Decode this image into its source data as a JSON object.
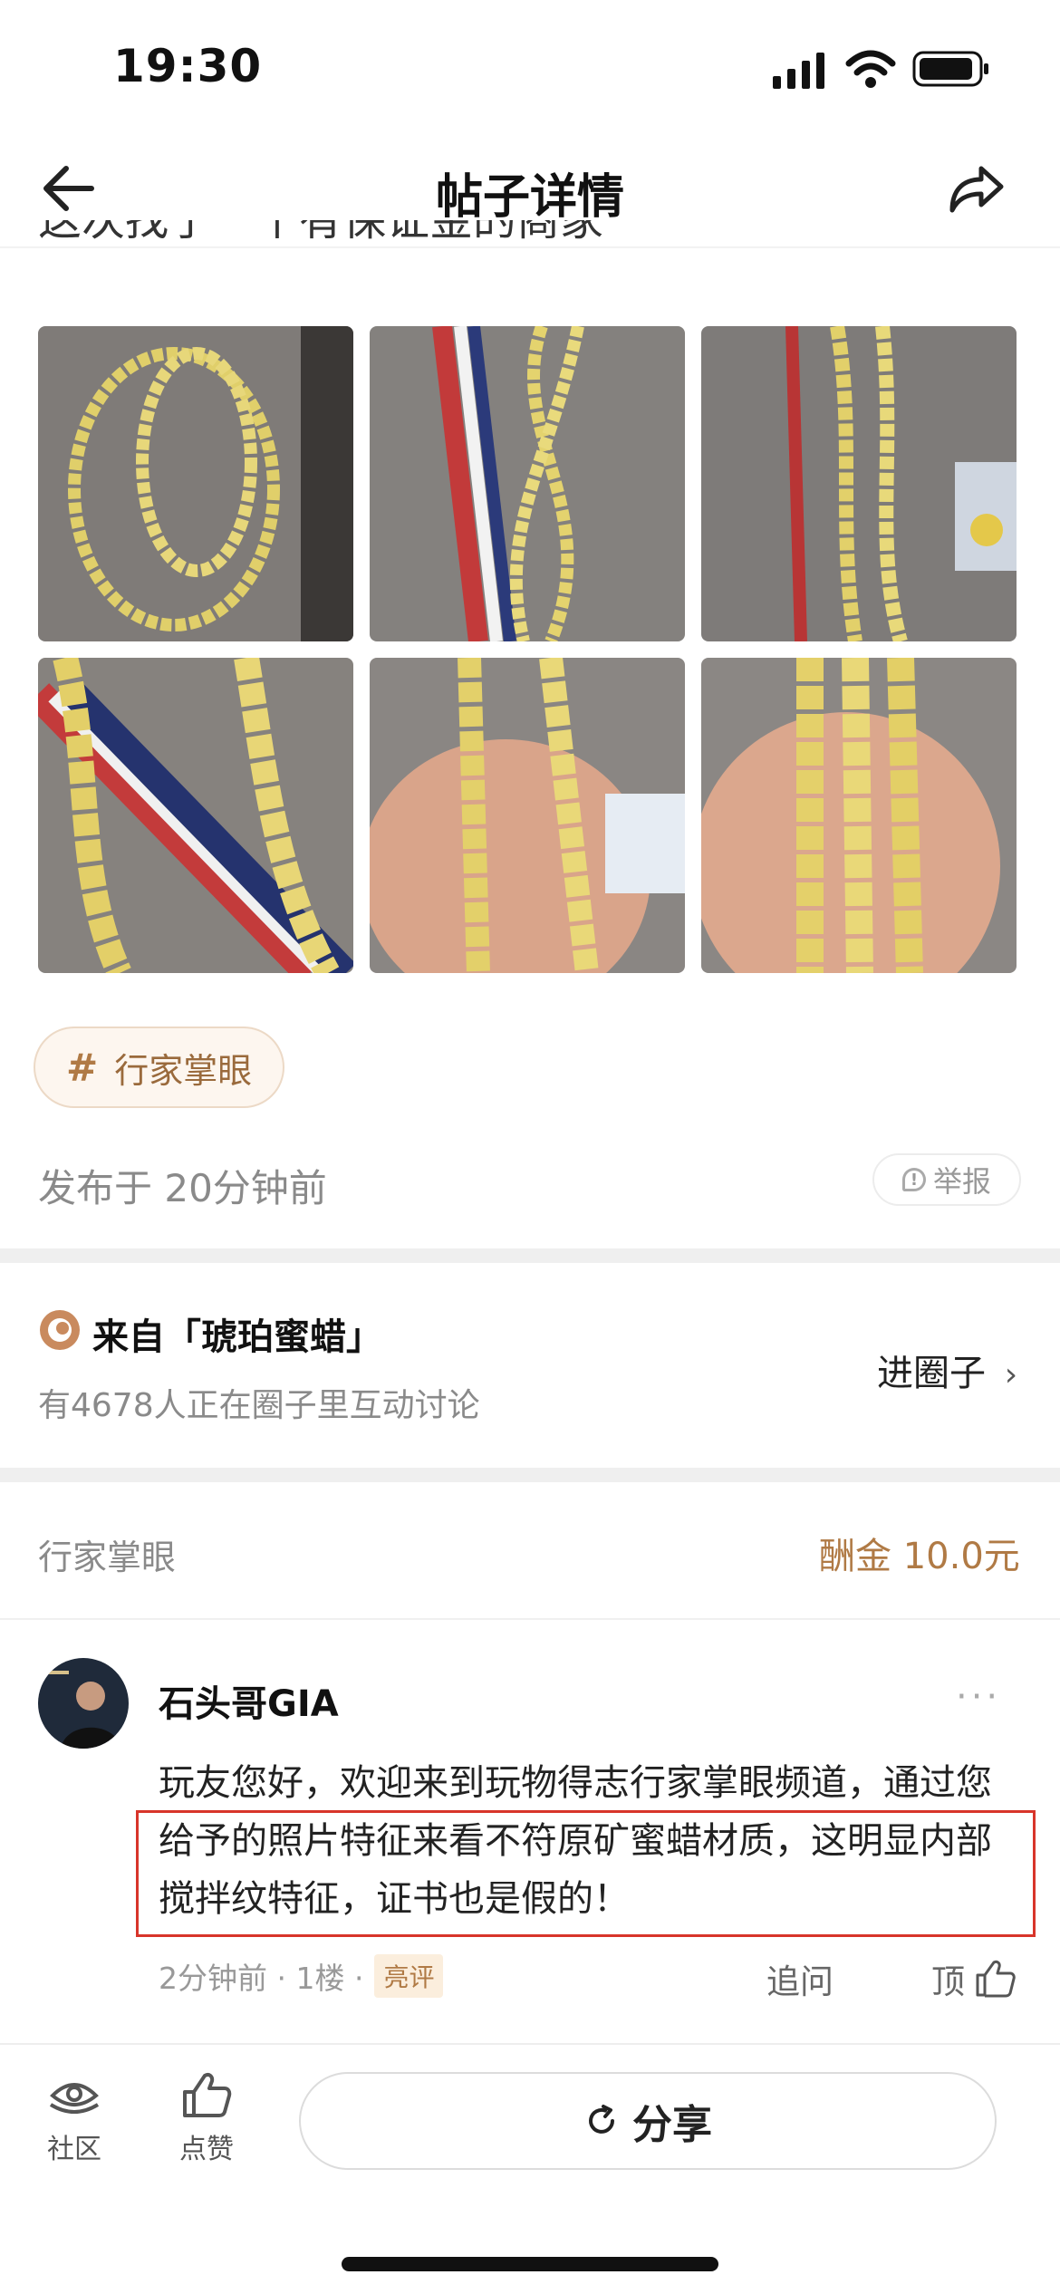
{
  "status_bar": {
    "time": "19:30"
  },
  "nav": {
    "title": "帖子详情"
  },
  "post": {
    "cut_text": "这次找了一个有保证金的商家",
    "topic_tag": "行家掌眼",
    "published": "发布于 20分钟前",
    "report_label": "举报"
  },
  "circle": {
    "title": "来自「琥珀蜜蜡」",
    "subtitle": "有4678人正在圈子里互动讨论",
    "enter_label": "进圈子"
  },
  "reply_section": {
    "label": "行家掌眼",
    "reward": "酬金 10.0元"
  },
  "comment": {
    "username": "石头哥GIA",
    "text": "玩友您好，欢迎来到玩物得志行家掌眼频道，通过您给予的照片特征来看不符原矿蜜蜡材质，这明显内部搅拌纹特征，证书也是假的！",
    "meta": "2分钟前 · 1楼 ·",
    "badge": "亮评",
    "ask_label": "追问",
    "top_label": "顶"
  },
  "bottom_bar": {
    "community_label": "社区",
    "like_label": "点赞",
    "share_label": "分享"
  },
  "icons": {
    "back": "arrow-left-icon",
    "share": "share-arrow-icon",
    "signal": "cellular-signal-icon",
    "wifi": "wifi-icon",
    "battery": "battery-icon"
  },
  "colors": {
    "accent_brown": "#b07a45",
    "highlight_red": "#d8352a"
  }
}
